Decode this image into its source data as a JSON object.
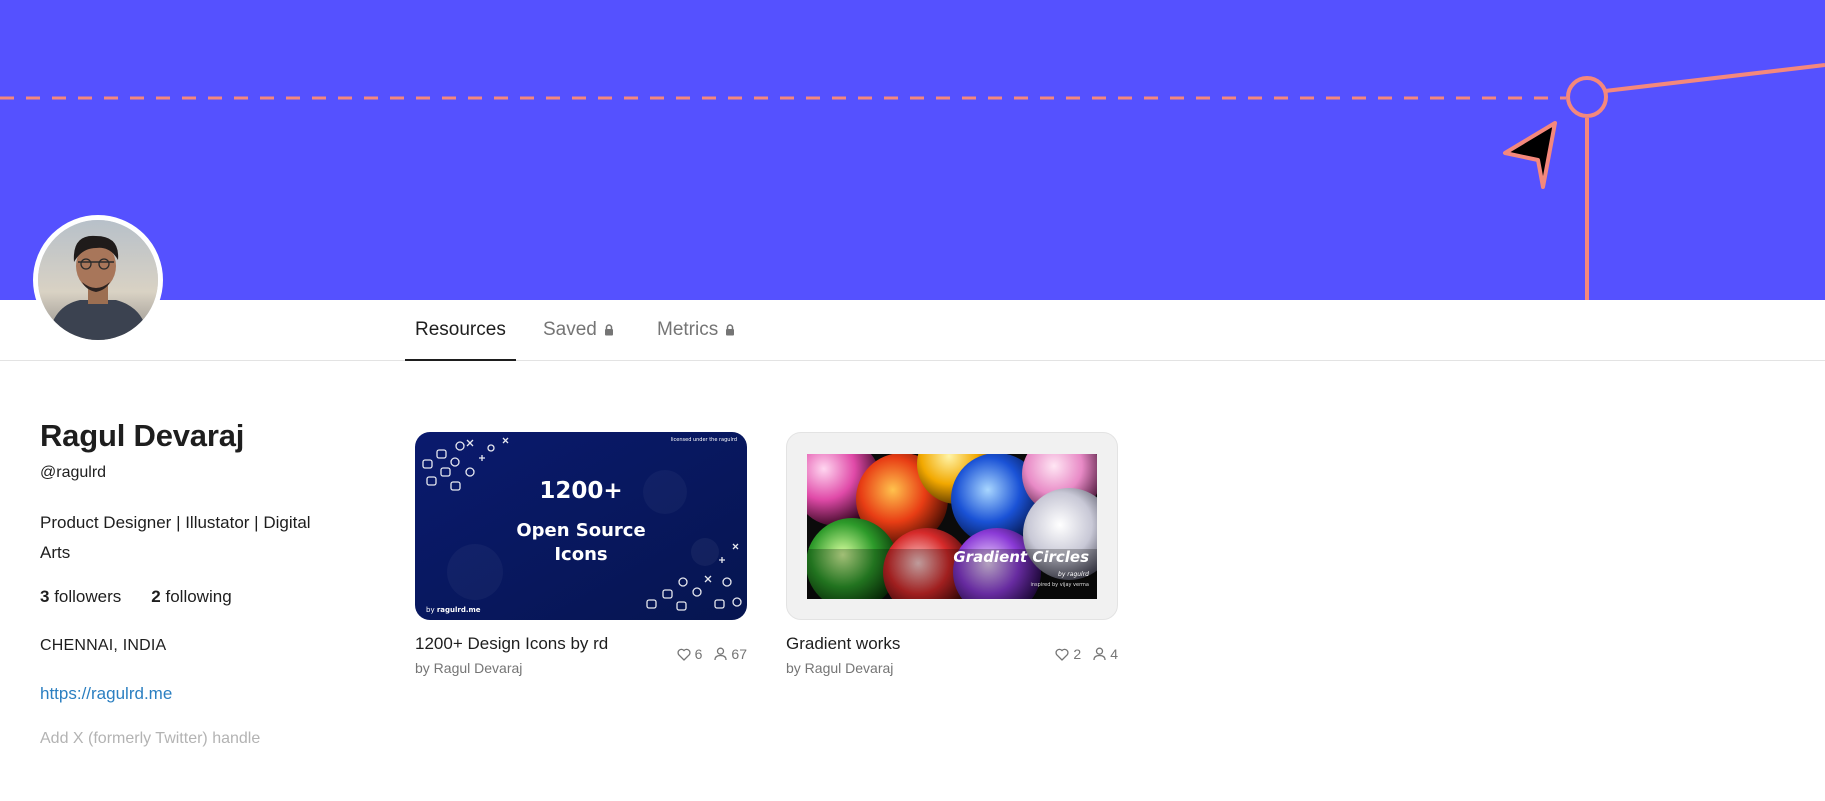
{
  "theme": {
    "banner_color": "#5551ff",
    "accent_line": "#f4887c",
    "link_color": "#2b7fc1"
  },
  "tabs": [
    {
      "label": "Resources",
      "active": true,
      "locked": false
    },
    {
      "label": "Saved",
      "active": false,
      "locked": true
    },
    {
      "label": "Metrics",
      "active": false,
      "locked": true
    }
  ],
  "profile": {
    "name": "Ragul Devaraj",
    "handle": "@ragulrd",
    "bio": "Product Designer | Illustator | Digital Arts",
    "followers_count": "3",
    "followers_label": "followers",
    "following_count": "2",
    "following_label": "following",
    "location": "CHENNAI, INDIA",
    "website": "https://ragulrd.me",
    "twitter_placeholder": "Add X (formerly Twitter) handle"
  },
  "resources": [
    {
      "title": "1200+ Design Icons by rd",
      "author": "by Ragul Devaraj",
      "likes": "6",
      "users": "67",
      "thumb": {
        "headline": "1200+",
        "subline1": "Open Source",
        "subline2": "Icons",
        "corner_text": "licensed under the ragulrd",
        "byline_prefix": "by ",
        "byline_brand": "ragulrd.me"
      }
    },
    {
      "title": "Gradient works",
      "author": "by Ragul Devaraj",
      "likes": "2",
      "users": "4",
      "thumb": {
        "headline": "Gradient Circles",
        "byline": "by ragulrd",
        "credit": "inspired by vijay verma"
      }
    }
  ]
}
